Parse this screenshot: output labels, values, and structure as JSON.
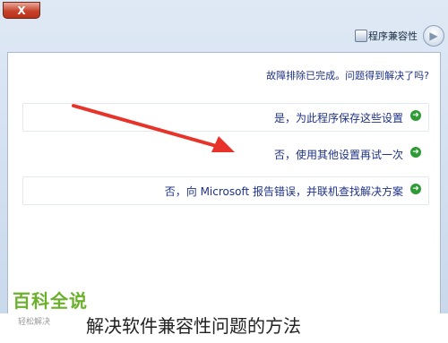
{
  "window": {
    "close_glyph": "X",
    "title": "程序兼容性",
    "back_icon": "back-arrow-icon"
  },
  "dialog": {
    "question": "故障排除已完成。问题得到解决了吗?",
    "options": [
      {
        "label": "是，为此程序保存这些设置",
        "icon": "green-arrow-icon"
      },
      {
        "label": "否，使用其他设置再试一次",
        "icon": "green-arrow-icon"
      },
      {
        "label": "否，向 Microsoft 报告错误，并联机查找解决方案",
        "icon": "green-arrow-icon"
      }
    ]
  },
  "annotation": {
    "color": "#e8332a",
    "icon": "red-pointer-arrow"
  },
  "watermark": {
    "logo": "百科全说",
    "sub": "轻松解决"
  },
  "caption": "解决软件兼容性问题的方法",
  "colors": {
    "link_text": "#1e3287",
    "arrow_green": "#2e9a36"
  }
}
